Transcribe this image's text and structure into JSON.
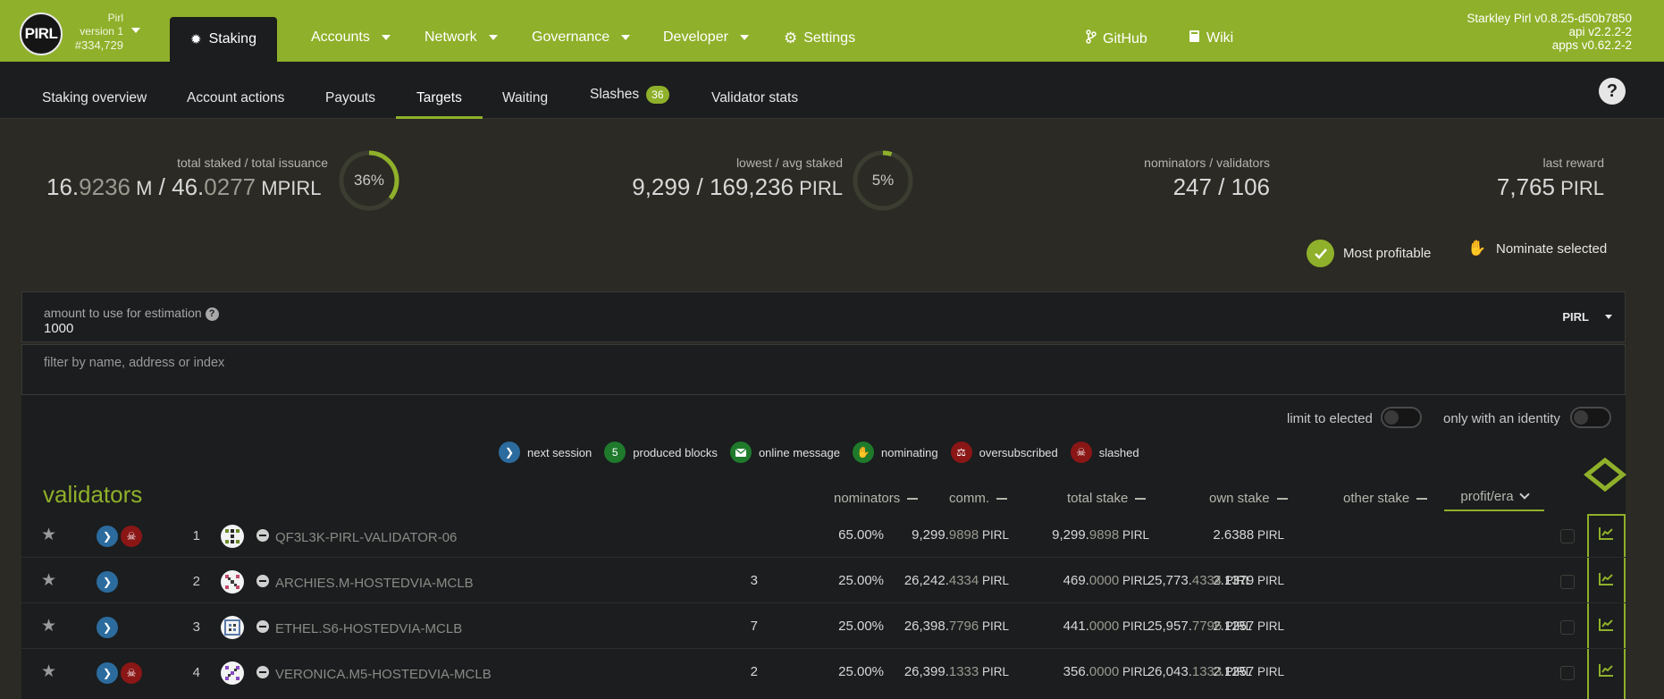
{
  "header": {
    "logo_text": "PIRL",
    "chain": "Pirl",
    "chain_version": "version 1",
    "block": "#334,729",
    "nav_active": "Staking",
    "nav": [
      "Accounts",
      "Network",
      "Governance",
      "Developer",
      "Settings"
    ],
    "links": [
      "GitHub",
      "Wiki"
    ],
    "version_lines": [
      "Starkley Pirl v0.8.25-d50b7850",
      "api v2.2.2-2",
      "apps v0.62.2-2"
    ],
    "accent_color": "#8fb02a"
  },
  "tabs": {
    "items": [
      "Staking overview",
      "Account actions",
      "Payouts",
      "Targets",
      "Waiting",
      "Slashes",
      "Validator stats"
    ],
    "active": "Targets",
    "slashes_badge": "36"
  },
  "summary": {
    "total": {
      "label": "total staked / total issuance",
      "staked_int": "16.",
      "staked_dec": "9236",
      "staked_unit": " M",
      "sep": " / ",
      "issuance_int": "46.",
      "issuance_dec": "0277",
      "issuance_unit": " MPIRL",
      "percent": "36%",
      "fraction": 0.36
    },
    "lowest": {
      "label": "lowest / avg staked",
      "value": "9,299 / 169,236",
      "unit": " PIRL",
      "percent": "5%",
      "fraction": 0.05
    },
    "nominators": {
      "label": "nominators / validators",
      "value": "247 / 106"
    },
    "reward": {
      "label": "last reward",
      "value": "7,765",
      "unit": " PIRL"
    }
  },
  "actions": {
    "most_profitable": "Most profitable",
    "nominate_selected": "Nominate selected"
  },
  "estimation": {
    "label": "amount to use for estimation",
    "value": "1000",
    "unit": "PIRL"
  },
  "filter": {
    "placeholder": "filter by name, address or index"
  },
  "toggles": {
    "limit_elected": "limit to elected",
    "only_identity": "only with an identity"
  },
  "legend": {
    "next_session": "next session",
    "produced_blocks_count": "5",
    "produced_blocks": "produced blocks",
    "online_message": "online message",
    "nominating": "nominating",
    "oversubscribed": "oversubscribed",
    "slashed": "slashed"
  },
  "table": {
    "title": "validators",
    "columns": {
      "nominators": "nominators",
      "comm": "comm.",
      "total_stake": "total stake",
      "own_stake": "own stake",
      "other_stake": "other stake",
      "profit": "profit/era"
    },
    "rows": [
      {
        "index": "1",
        "name": "QF3L3K-PIRL-VALIDATOR-06",
        "slashed": true,
        "nominators": "",
        "comm": "65.00%",
        "total_int": "9,299.",
        "total_dec": "9898",
        "own_int": "9,299.",
        "own_dec": "9898",
        "other_int": "",
        "other_dec": "",
        "other_unit": "",
        "profit": "2.6388",
        "unit": " PIRL"
      },
      {
        "index": "2",
        "name": "ARCHIES.M-HOSTEDVIA-MCLB",
        "slashed": false,
        "nominators": "3",
        "comm": "25.00%",
        "total_int": "26,242.",
        "total_dec": "4334",
        "own_int": "469.",
        "own_dec": "0000",
        "other_int": "25,773.",
        "other_dec": "4334",
        "other_unit": " PIRL",
        "profit": "2.1379",
        "unit": " PIRL"
      },
      {
        "index": "3",
        "name": "ETHEL.S6-HOSTEDVIA-MCLB",
        "slashed": false,
        "nominators": "7",
        "comm": "25.00%",
        "total_int": "26,398.",
        "total_dec": "7796",
        "own_int": "441.",
        "own_dec": "0000",
        "other_int": "25,957.",
        "other_dec": "7796",
        "other_unit": " PIRL",
        "profit": "2.1257",
        "unit": " PIRL"
      },
      {
        "index": "4",
        "name": "VERONICA.M5-HOSTEDVIA-MCLB",
        "slashed": true,
        "nominators": "2",
        "comm": "25.00%",
        "total_int": "26,399.",
        "total_dec": "1333",
        "own_int": "356.",
        "own_dec": "0000",
        "other_int": "26,043.",
        "other_dec": "1333",
        "other_unit": " PIRL",
        "profit": "2.1257",
        "unit": " PIRL"
      }
    ]
  }
}
